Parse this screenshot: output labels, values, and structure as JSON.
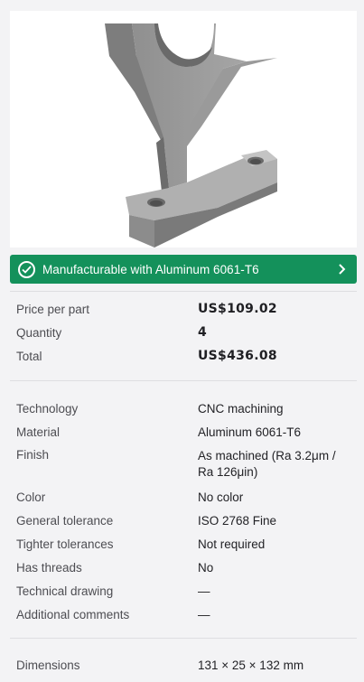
{
  "status": {
    "message": "Manufacturable with Aluminum 6061-T6",
    "icon": "check-circle-icon",
    "color": "#14915b"
  },
  "pricing": [
    {
      "label": "Price per part",
      "value": "US$109.02"
    },
    {
      "label": "Quantity",
      "value": "4"
    },
    {
      "label": "Total",
      "value": "US$436.08"
    }
  ],
  "specs": [
    {
      "label": "Technology",
      "value": "CNC machining"
    },
    {
      "label": "Material",
      "value": "Aluminum 6061-T6"
    },
    {
      "label": "Finish",
      "value": "As machined (Ra 3.2μm / Ra 126μin)"
    },
    {
      "label": "Color",
      "value": "No color"
    },
    {
      "label": "General tolerance",
      "value": "ISO 2768 Fine"
    },
    {
      "label": "Tighter tolerances",
      "value": "Not required"
    },
    {
      "label": "Has threads",
      "value": "No"
    },
    {
      "label": "Technical drawing",
      "value": "—"
    },
    {
      "label": "Additional comments",
      "value": "—"
    }
  ],
  "dimensions": {
    "label": "Dimensions",
    "value": "131 × 25 × 132 mm"
  }
}
